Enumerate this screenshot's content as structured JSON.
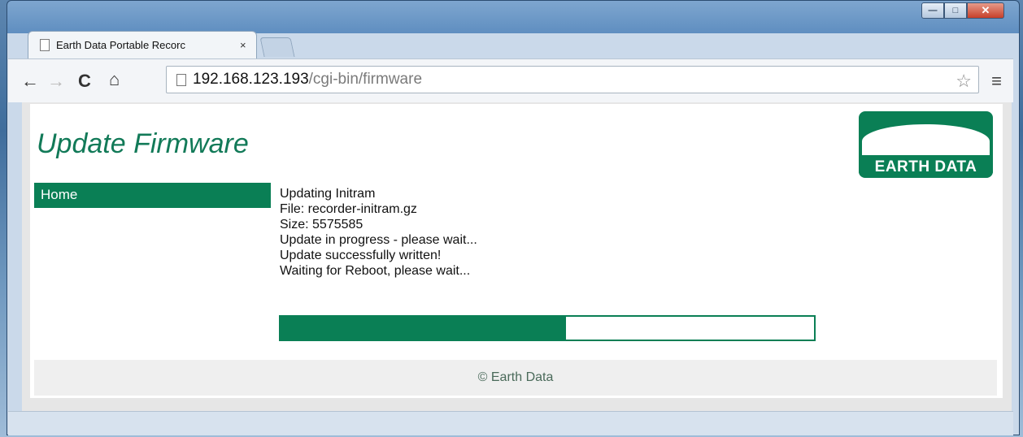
{
  "browser": {
    "tab_title": "Earth Data Portable Recorc",
    "tab_close": "×",
    "url_host": "192.168.123.193",
    "url_path": "/cgi-bin/firmware",
    "icons": [
      "back-arrow-icon",
      "forward-arrow-icon",
      "reload-icon",
      "home-icon",
      "page-icon",
      "star-icon",
      "menu-icon"
    ],
    "window_controls": {
      "minimize": "—",
      "maximize": "□",
      "close": "✕"
    }
  },
  "page": {
    "title": "Update Firmware",
    "logo_text": "EARTH DATA",
    "nav": [
      {
        "label": "Home"
      }
    ],
    "status_lines": [
      "Updating Initram",
      "File: recorder-initram.gz",
      "Size: 5575585",
      "Update in progress - please wait...",
      "Update successfully written!",
      "Waiting for Reboot, please wait..."
    ],
    "progress_fraction": 0.535,
    "footer": "© Earth Data"
  },
  "colors": {
    "brand_green": "#0a7f55",
    "title_green": "#127a58",
    "footer_bg": "#efefef"
  }
}
